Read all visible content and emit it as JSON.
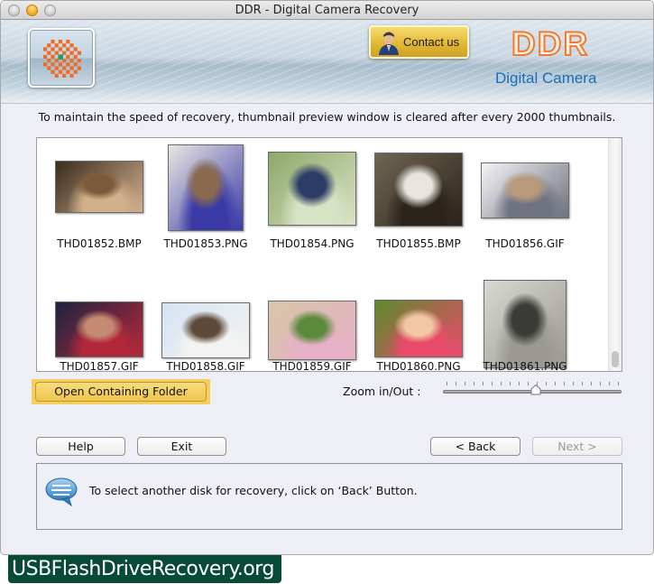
{
  "window": {
    "title": "DDR - Digital Camera Recovery",
    "traffic_lights": [
      "close",
      "minimize",
      "zoom"
    ]
  },
  "banner": {
    "contact_label": "Contact us",
    "brand_title": "DDR",
    "brand_subtitle": "Digital Camera",
    "colors": {
      "brand_orange": "#f07a2e",
      "subtitle_blue": "#1a6fb7",
      "contact_gold": "#e0b531"
    }
  },
  "info_message": "To maintain the speed of recovery, thumbnail preview window is cleared after every 2000 thumbnails.",
  "thumbnails": [
    {
      "name": "THD01852.BMP",
      "icon": "photo-girl-with-hat"
    },
    {
      "name": "THD01853.PNG",
      "icon": "photo-girl-braid"
    },
    {
      "name": "THD01854.PNG",
      "icon": "photo-woman-reading"
    },
    {
      "name": "THD01855.BMP",
      "icon": "photo-woman-white-dress"
    },
    {
      "name": "THD01856.GIF",
      "icon": "photo-couple-snow"
    },
    {
      "name": "THD01857.GIF",
      "icon": "photo-woman-braids"
    },
    {
      "name": "THD01858.GIF",
      "icon": "photo-woman-sitting-outdoors"
    },
    {
      "name": "THD01859.GIF",
      "icon": "photo-mother-daughter-sofa"
    },
    {
      "name": "THD01860.PNG",
      "icon": "photo-baby-smiling"
    },
    {
      "name": "THD01861.PNG",
      "icon": "photo-black-white-portrait"
    }
  ],
  "thumbnail_scroll": {
    "position_fraction": 1.0
  },
  "controls": {
    "open_folder_label": "Open Containing Folder",
    "zoom_label": "Zoom in/Out :",
    "zoom_slider": {
      "ticks": 20,
      "value_fraction": 0.52
    }
  },
  "buttons": {
    "help": "Help",
    "exit": "Exit",
    "back": "< Back",
    "next": "Next >",
    "next_enabled": false
  },
  "status": {
    "icon": "speech-bubble-icon",
    "message": "To select another disk for recovery, click on ‘Back’ Button."
  },
  "watermark": "USBFlashDriveRecovery.org"
}
